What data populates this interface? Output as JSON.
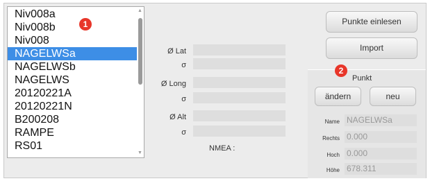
{
  "list": {
    "items": [
      "Niv008a",
      "Niv008b",
      "Niv008",
      "NAGELWSa",
      "NAGELWSb",
      "NAGELWS",
      "20120221A",
      "20120221N",
      "B200208",
      "RAMPE",
      "RS01"
    ],
    "selected_index": 3,
    "badge": "1"
  },
  "coords": {
    "lat_label": "Ø Lat",
    "sigma_label": "σ",
    "long_label": "Ø Long",
    "alt_label": "Ø Alt",
    "nmea_label": "NMEA :"
  },
  "buttons": {
    "read_points": "Punkte einlesen",
    "import": "Import"
  },
  "punkt": {
    "badge": "2",
    "title": "Punkt",
    "change_button": "ändern",
    "new_button": "neu",
    "name_label": "Name",
    "name_value": "NAGELWSa",
    "rechts_label": "Rechts",
    "rechts_value": "0.000",
    "hoch_label": "Hoch",
    "hoch_value": "0.000",
    "hoehe_label": "Höhe",
    "hoehe_value": "678.311"
  },
  "colors": {
    "selection": "#3d8ee6",
    "badge": "#e8362a"
  }
}
